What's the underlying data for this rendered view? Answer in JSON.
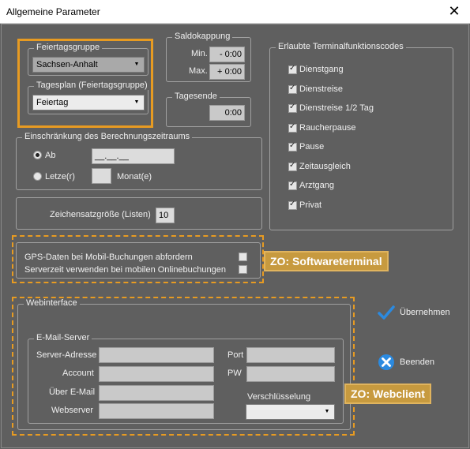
{
  "window": {
    "title": "Allgemeine Parameter",
    "close_glyph": "✕"
  },
  "feiertagsgruppe": {
    "legend": "Feiertagsgruppe",
    "value": "Sachsen-Anhalt"
  },
  "tagesplan": {
    "legend": "Tagesplan (Feiertagsgruppe)",
    "value": "Feiertag"
  },
  "saldokappung": {
    "legend": "Saldokappung",
    "min_label": "Min.",
    "min_sign": "-",
    "min_value": "0:00",
    "max_label": "Max.",
    "max_sign": "+",
    "max_value": "0:00"
  },
  "tagesende": {
    "legend": "Tagesende",
    "value": "0:00"
  },
  "einschraenkung": {
    "legend": "Einschränkung des Berechnungszeitraums",
    "ab_label": "Ab",
    "ab_value": "__.__.__",
    "letzte_label": "Letze(r)",
    "letzte_value": "",
    "monat_label": "Monat(e)"
  },
  "zeichensatz": {
    "label": "Zeichensatzgröße (Listen)",
    "value": "10"
  },
  "terminalfunktionen": {
    "legend": "Erlaubte Terminalfunktionscodes",
    "items": [
      {
        "label": "Dienstgang",
        "checked": true
      },
      {
        "label": "Dienstreise",
        "checked": true
      },
      {
        "label": "Dienstreise 1/2 Tag",
        "checked": true
      },
      {
        "label": "Raucherpause",
        "checked": true
      },
      {
        "label": "Pause",
        "checked": true
      },
      {
        "label": "Zeitausgleich",
        "checked": true
      },
      {
        "label": "Arztgang",
        "checked": true
      },
      {
        "label": "Privat",
        "checked": true
      }
    ]
  },
  "mobile": {
    "gps_label": "GPS-Daten bei Mobil-Buchungen abfordern",
    "serverzeit_label": "Serverzeit verwenden bei mobilen Onlinebuchungen",
    "tag": "ZO: Softwareterminal"
  },
  "webinterface": {
    "legend": "Webinterface",
    "email_legend": "E-Mail-Server",
    "server_label": "Server-Adresse",
    "account_label": "Account",
    "uebermail_label": "Über E-Mail",
    "webserver_label": "Webserver",
    "port_label": "Port",
    "pw_label": "PW",
    "verschluesselung_label": "Verschlüsselung",
    "tag": "ZO: Webclient"
  },
  "actions": {
    "uebernehmen": "Übernehmen",
    "beenden": "Beenden"
  },
  "colors": {
    "accent_orange": "#e79b22",
    "check_blue": "#2b8ae0"
  }
}
